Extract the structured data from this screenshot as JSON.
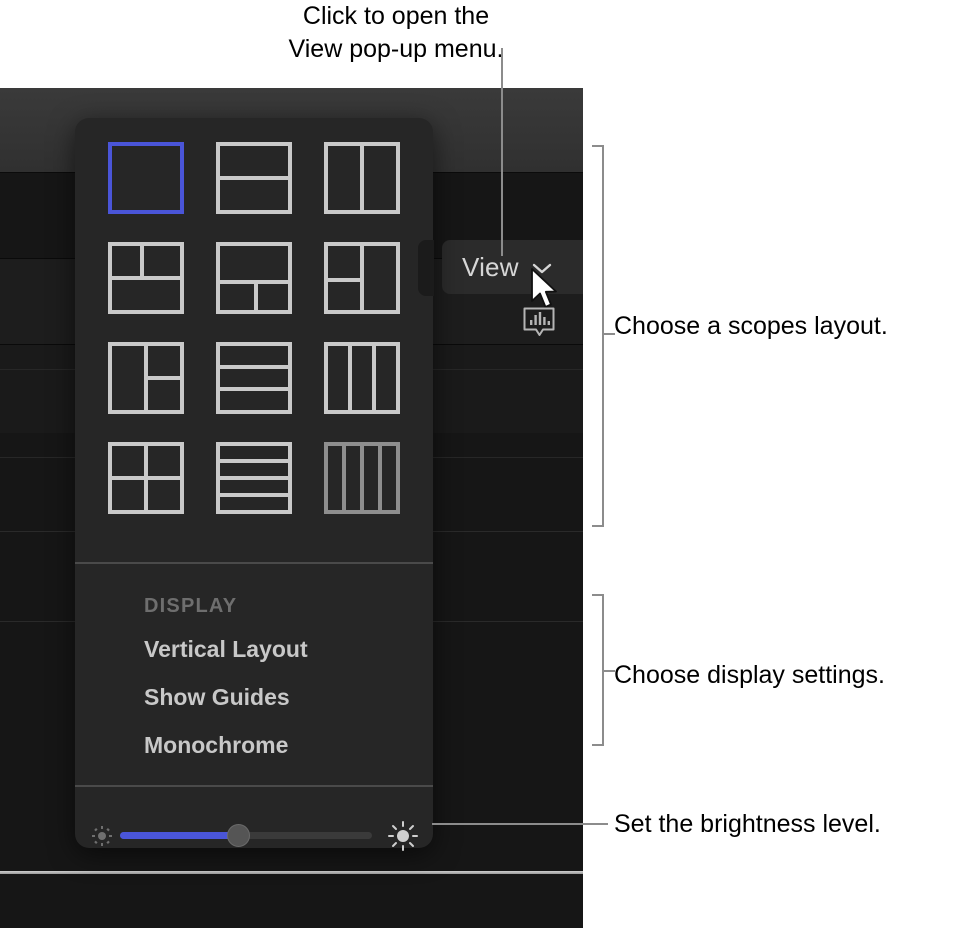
{
  "annotations": {
    "top_callout": "Click to open the\nView pop-up menu.",
    "scopes_callout": "Choose a scopes layout.",
    "display_callout": "Choose display settings.",
    "brightness_callout": "Set the brightness level.",
    "leader_color": "#8c8c8c"
  },
  "toolbar": {
    "view_button_label": "View",
    "chevron_icon": "chevron-down-icon",
    "scopes_icon": "audio-scopes-icon",
    "cursor_icon": "mouse-pointer-icon"
  },
  "popup": {
    "accent_color": "#4a55d8",
    "background_color": "#262626",
    "stroke_color": "#c9c9c9",
    "selected_layout_index": 0,
    "layouts": [
      {
        "name": "single-pane",
        "selected": true,
        "cols": 1,
        "rows": 1,
        "pattern": "1"
      },
      {
        "name": "two-rows",
        "selected": false,
        "cols": 1,
        "rows": 2,
        "pattern": "1/1"
      },
      {
        "name": "two-columns",
        "selected": false,
        "cols": 2,
        "rows": 1,
        "pattern": "1|1"
      },
      {
        "name": "two-top-one-bottom",
        "selected": false,
        "pattern": "2/1"
      },
      {
        "name": "one-top-two-bottom",
        "selected": false,
        "pattern": "1/2"
      },
      {
        "name": "two-left-one-right",
        "selected": false,
        "pattern": "2|1"
      },
      {
        "name": "one-left-two-right",
        "selected": false,
        "pattern": "1|2"
      },
      {
        "name": "three-rows",
        "selected": false,
        "cols": 1,
        "rows": 3,
        "pattern": "1/1/1"
      },
      {
        "name": "three-columns",
        "selected": false,
        "cols": 3,
        "rows": 1,
        "pattern": "1|1|1"
      },
      {
        "name": "four-quadrants",
        "selected": false,
        "cols": 2,
        "rows": 2,
        "pattern": "2x2"
      },
      {
        "name": "four-rows",
        "selected": false,
        "cols": 1,
        "rows": 4,
        "pattern": "1/1/1/1"
      },
      {
        "name": "four-columns",
        "selected": false,
        "cols": 4,
        "rows": 1,
        "pattern": "1|1|1|1"
      }
    ],
    "display_section": {
      "header": "DISPLAY",
      "items": [
        {
          "label": "Vertical Layout",
          "checked": false
        },
        {
          "label": "Show Guides",
          "checked": false
        },
        {
          "label": "Monochrome",
          "checked": false
        }
      ]
    },
    "brightness": {
      "low_icon": "sun-small-icon",
      "high_icon": "sun-large-icon",
      "value_percent": 48,
      "fill_color": "#4a55d8"
    }
  }
}
